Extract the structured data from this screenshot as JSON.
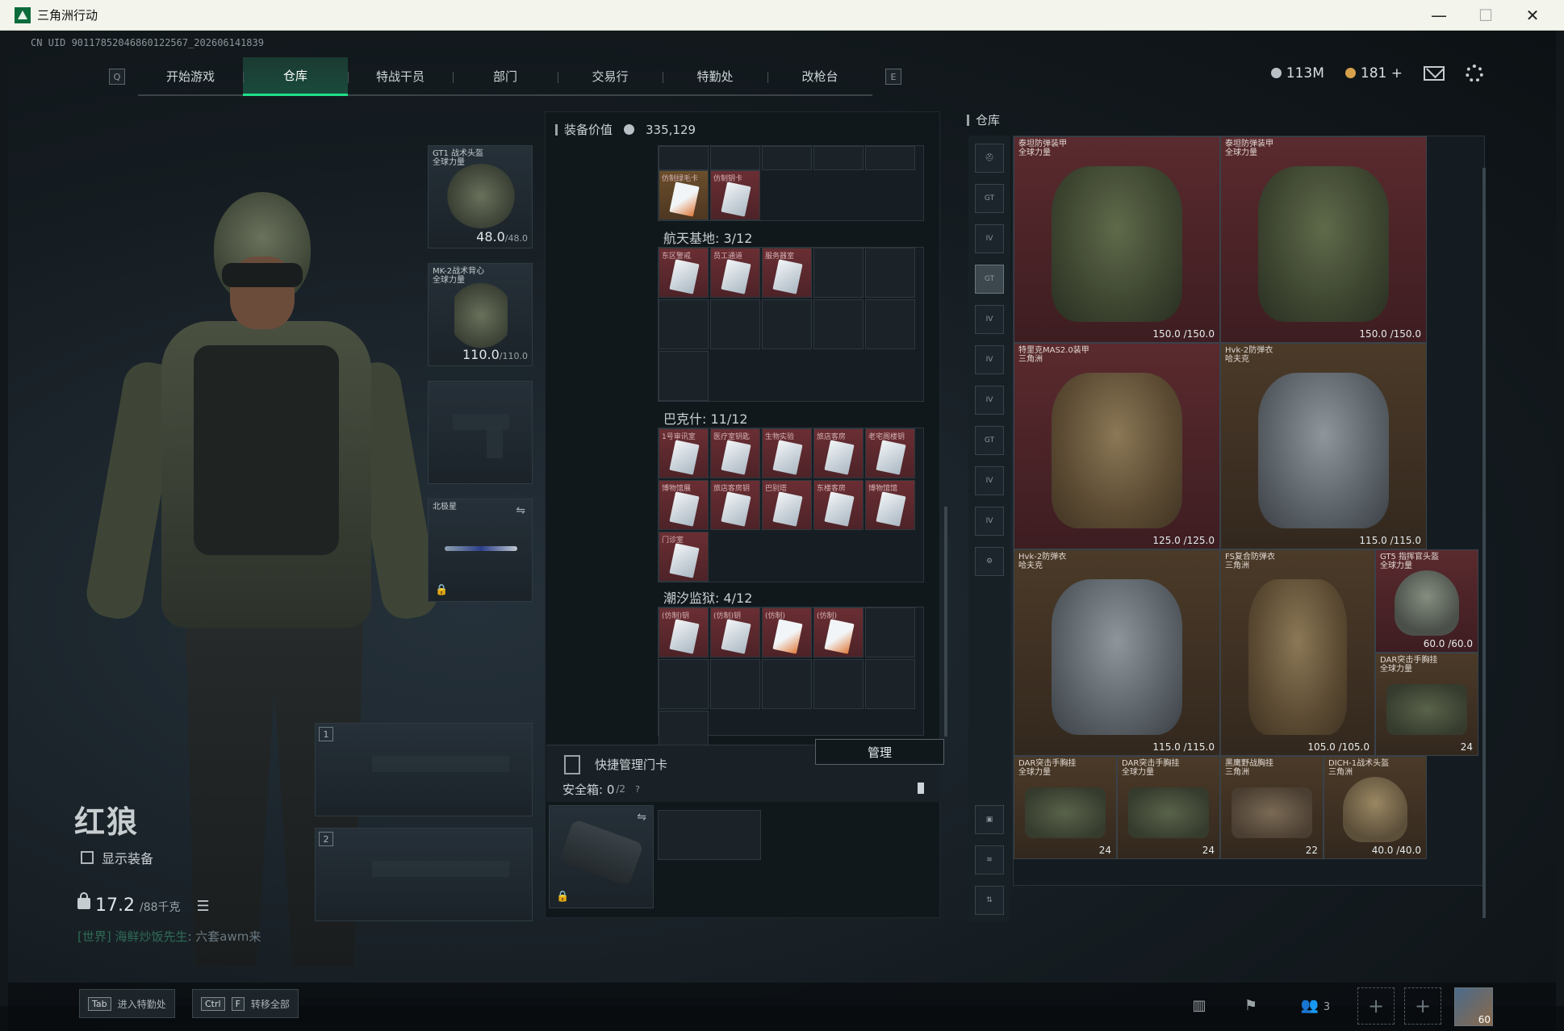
{
  "window": {
    "title": "三角洲行动",
    "minimize": "—",
    "maximize": "☐",
    "close": "✕"
  },
  "uid": "CN UID 9011785204686012256​7_202606141839",
  "nav": {
    "key_left": "Q",
    "key_right": "E",
    "tabs": [
      "开始游戏",
      "仓库",
      "特战干员",
      "部门",
      "交易行",
      "特勤处",
      "改枪台"
    ],
    "active": "仓库"
  },
  "currency": {
    "silver": "113M",
    "gold": "181",
    "gold_add": "+"
  },
  "character": {
    "name": "红狼",
    "show_equipment": "显示装备",
    "weight": "17.2",
    "weight_max": "/88千克",
    "chat_channel": "[世界] 海鲜炒饭先生",
    "chat_message": ": 六套awm来"
  },
  "equipment": {
    "helmet": {
      "label": "GT1 战术头盔\n全球力量",
      "dur": "48.0",
      "max": "/48.0"
    },
    "armor": {
      "label": "MK-2战术背心\n全球力量",
      "dur": "110.0",
      "max": "/110.0"
    },
    "melee": {
      "label": "北极星"
    },
    "slot1": "1",
    "slot2": "2"
  },
  "middle": {
    "equip_value_label": "装备价值",
    "equip_value": "335,129",
    "sections": [
      {
        "title": "航天基地: 3/12",
        "cards": [
          "东区警戒",
          "员工通道",
          "服务器室"
        ]
      },
      {
        "title": "巴克什: 11/12",
        "cards": [
          "1号审讯室",
          "医疗室钥匙",
          "生物实验",
          "旅店客房",
          "老宅阁楼钥",
          "博物馆展",
          "旅店客房钥",
          "巴别塔",
          "东楼客房",
          "博物馆馆",
          "门诊室"
        ]
      },
      {
        "title": "潮汐监狱: 4/12",
        "cards": [
          "(仿制)钥",
          "(仿制)钥",
          "(仿制)",
          "(仿制)"
        ]
      }
    ],
    "top_cards": [
      "仿制绿毛卡",
      "仿制钥卡"
    ],
    "quick_manage": "快捷管理门卡",
    "manage_btn": "管理",
    "safe_box": "安全箱: 0",
    "safe_box_max": "/2",
    "safe_box_help": "?"
  },
  "warehouse": {
    "title": "仓库",
    "items": [
      {
        "name": "泰坦防弹装甲\n全球力量",
        "dur": "150.0 /150.0"
      },
      {
        "name": "泰坦防弹装甲\n全球力量",
        "dur": "150.0 /150.0"
      },
      {
        "name": "特里克MAS2.0装甲\n三角洲",
        "dur": "125.0 /125.0"
      },
      {
        "name": "Hvk-2防弹衣\n哈夫克",
        "dur": "115.0 /115.0"
      },
      {
        "name": "Hvk-2防弹衣\n哈夫克",
        "dur": "115.0 /115.0"
      },
      {
        "name": "FS复合防弹衣\n三角洲",
        "dur": "105.0 /105.0"
      },
      {
        "name": "GT5 指挥官头盔\n全球力量",
        "dur": "60.0 /60.0"
      },
      {
        "name": "DAR突击手胸挂\n全球力量",
        "cnt": "24"
      },
      {
        "name": "DAR突击手胸挂\n全球力量",
        "cnt": "24"
      },
      {
        "name": "DAR突击手胸挂\n全球力量",
        "cnt": "24"
      },
      {
        "name": "黑鹰野战胸挂\n三角洲",
        "cnt": "22"
      },
      {
        "name": "DICH-1战术头盔\n三角洲",
        "dur": "40.0 /40.0"
      }
    ]
  },
  "bottom": {
    "k1": "Tab",
    "k1_label": "进入特勤处",
    "k2a": "Ctrl",
    "k2b": "F",
    "k2_label": "转移全部",
    "team": "3",
    "avatar_level": "60"
  }
}
